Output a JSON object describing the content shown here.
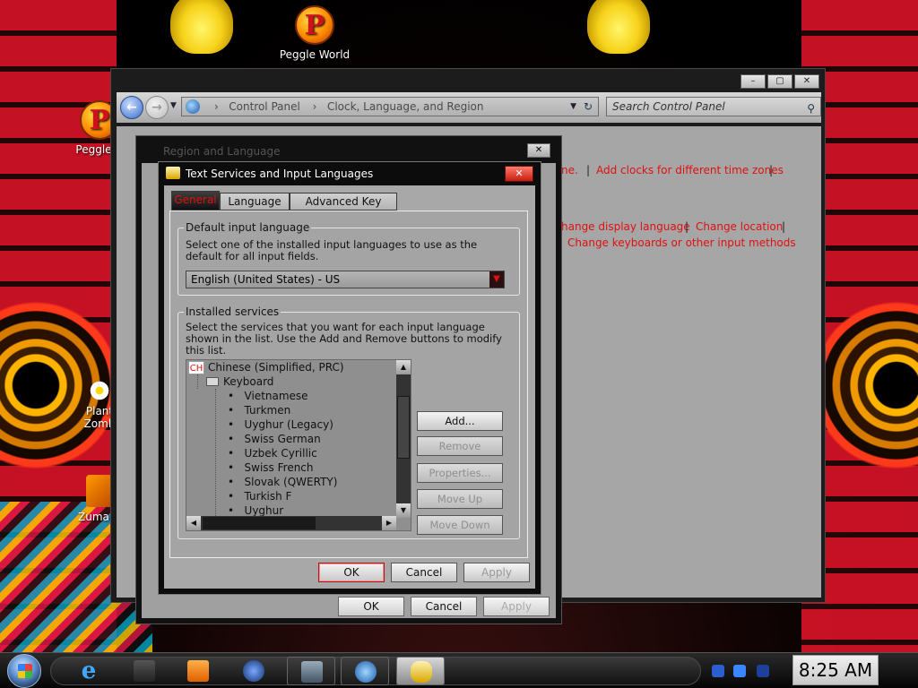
{
  "desktop": {
    "icons": [
      {
        "label": "Peggle World",
        "glyph": "P"
      },
      {
        "label": "Peggle D",
        "glyph": "P"
      },
      {
        "label": "Plant",
        "label2": "Zomb"
      },
      {
        "label": "Zuma D"
      }
    ]
  },
  "control_panel": {
    "caption_buttons": [
      "–",
      "▢",
      "✕"
    ],
    "breadcrumb": [
      "Control Panel",
      "Clock, Language, and Region"
    ],
    "search_placeholder": "Search Control Panel",
    "links": {
      "line1_tail": "ne.",
      "add_clocks": "Add clocks for different time zones",
      "change_display_language": "hange display language",
      "change_location": "Change location",
      "change_keyboards": "Change keyboards or other input methods"
    },
    "separator": "|"
  },
  "region_dialog": {
    "title": "Region and Language",
    "close": "✕",
    "buttons": {
      "ok": "OK",
      "cancel": "Cancel",
      "apply": "Apply"
    }
  },
  "text_services_dialog": {
    "title": "Text Services and Input Languages",
    "close": "✕",
    "tabs": [
      "General",
      "Language Bar",
      "Advanced Key Settings"
    ],
    "default_input": {
      "legend": "Default input language",
      "description": "Select one of the installed input languages to use as the default for all input fields.",
      "selected": "English (United States) - US"
    },
    "installed_services": {
      "legend": "Installed services",
      "description": "Select the services that you want for each input language shown in the list. Use the Add and Remove buttons to modify this list.",
      "language_badge": "CH",
      "language": "Chinese (Simplified, PRC)",
      "category": "Keyboard",
      "keyboards": [
        "Vietnamese",
        "Turkmen",
        "Uyghur (Legacy)",
        "Swiss German",
        "Uzbek Cyrillic",
        "Swiss French",
        "Slovak (QWERTY)",
        "Turkish F",
        "Uyghur"
      ],
      "buttons": {
        "add": "Add...",
        "remove": "Remove",
        "properties": "Properties...",
        "move_up": "Move Up",
        "move_down": "Move Down"
      }
    },
    "footer": {
      "ok": "OK",
      "cancel": "Cancel",
      "apply": "Apply"
    }
  },
  "taskbar": {
    "clock": "8:25 AM"
  }
}
